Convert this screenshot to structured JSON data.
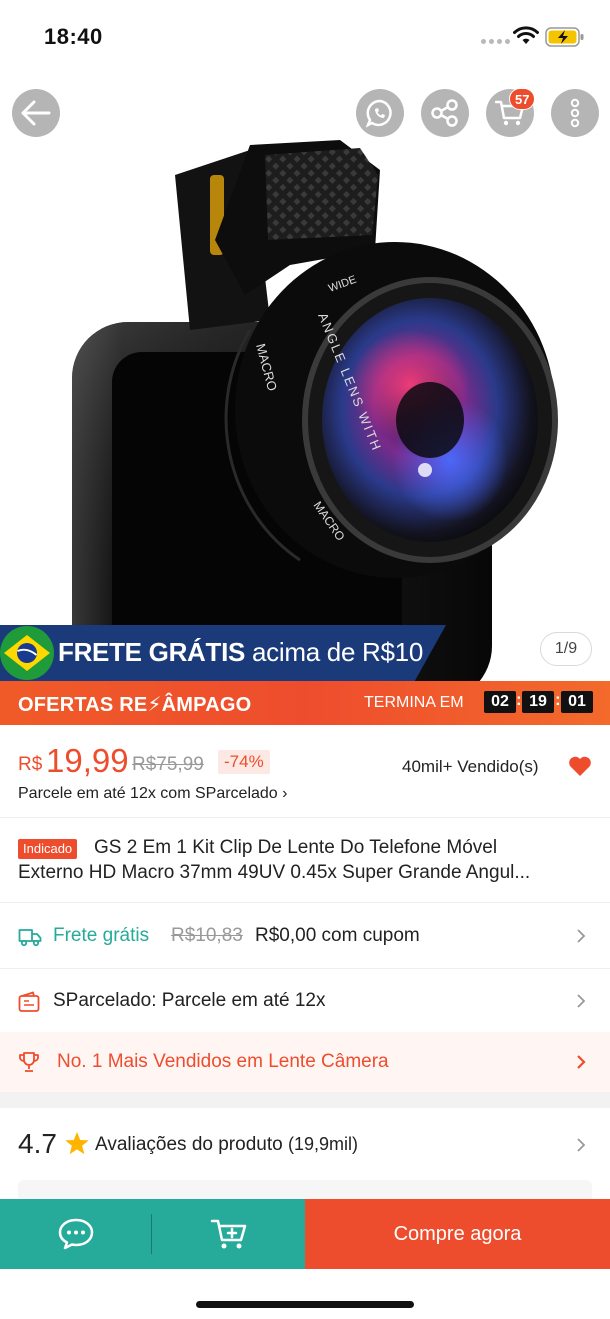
{
  "status_bar": {
    "time": "18:40"
  },
  "gallery": {
    "counter": "1/9",
    "lens_text": [
      "MACRO",
      "ANGLE LENS WITH",
      "WIDE",
      "MACRO"
    ]
  },
  "top_nav": {
    "cart_badge": "57"
  },
  "free_shipping_banner": {
    "bold": "FRETE GRÁTIS",
    "rest": " acima de R$10"
  },
  "flash_sale": {
    "title": "OFERTAS RE⚡ÂMPAGO",
    "ends_label": "TERMINA EM",
    "timer": {
      "hours": "02",
      "minutes": "19",
      "seconds": "01"
    }
  },
  "price": {
    "currency": "R$",
    "current": "19,99",
    "original": "R$75,99",
    "discount": "-74%",
    "sold": "40mil+ Vendido(s)",
    "installment": "Parcele em até 12x com SParcelado ›"
  },
  "product": {
    "tag": "Indicado",
    "title": "GS 2 Em 1 Kit Clip De Lente Do Telefone Móvel",
    "title_line2": "Externo HD Macro 37mm 49UV 0.45x Super Grande Angul..."
  },
  "shipping": {
    "label": "Frete grátis",
    "old": "R$10,83",
    "new": "R$0,00 com cupom"
  },
  "sparcelado": {
    "label": "SParcelado: Parcele em até 12x"
  },
  "bestseller": {
    "label": "No. 1 Mais Vendidos em Lente Câmera"
  },
  "reviews": {
    "rating": "4.7",
    "label": "Avaliações do produto",
    "count": "(19,9mil)"
  },
  "bottom_bar": {
    "buy_label": "Compre agora"
  },
  "colors": {
    "primary": "#ee4d2d",
    "teal": "#26aa99",
    "banner_blue": "#1b3a7a"
  }
}
